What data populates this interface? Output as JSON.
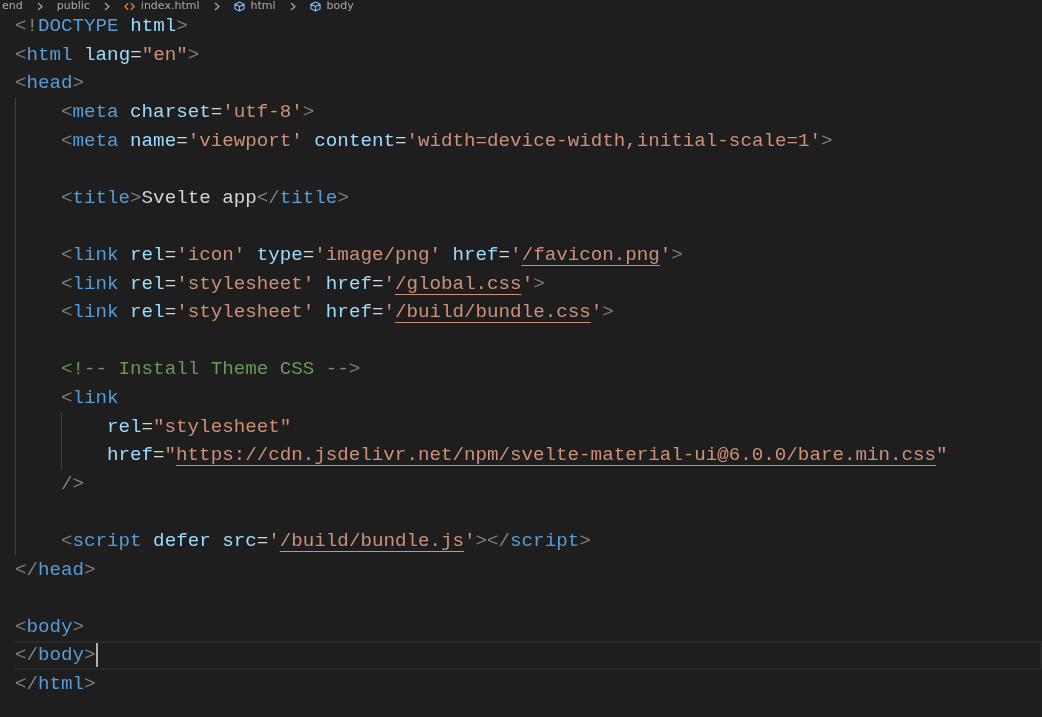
{
  "breadcrumb": [
    {
      "label": "end",
      "kind": "folder"
    },
    {
      "label": "public",
      "kind": "folder"
    },
    {
      "label": "index.html",
      "kind": "file"
    },
    {
      "label": "html",
      "kind": "element"
    },
    {
      "label": "body",
      "kind": "element"
    }
  ],
  "lines": [
    {
      "kind": "code",
      "current": false,
      "tokens": [
        {
          "kind": "punct",
          "text": "<!"
        },
        {
          "kind": "tag",
          "text": "DOCTYPE"
        },
        {
          "kind": "attr",
          "text": " html"
        },
        {
          "kind": "punct",
          "text": ">"
        }
      ]
    },
    {
      "kind": "code",
      "current": false,
      "tokens": [
        {
          "kind": "punct",
          "text": "<"
        },
        {
          "kind": "tag",
          "text": "html"
        },
        {
          "kind": "attr",
          "text": " lang"
        },
        {
          "kind": "text",
          "text": "="
        },
        {
          "kind": "string",
          "text": "\"en\""
        },
        {
          "kind": "punct",
          "text": ">"
        }
      ]
    },
    {
      "kind": "code",
      "current": false,
      "tokens": [
        {
          "kind": "punct",
          "text": "<"
        },
        {
          "kind": "tag",
          "text": "head"
        },
        {
          "kind": "punct",
          "text": ">"
        }
      ],
      "children": [
        {
          "kind": "code",
          "current": false,
          "tokens": [
            {
              "kind": "punct",
              "text": "<"
            },
            {
              "kind": "tag",
              "text": "meta"
            },
            {
              "kind": "attr",
              "text": " charset"
            },
            {
              "kind": "text",
              "text": "="
            },
            {
              "kind": "string",
              "text": "'utf-8'"
            },
            {
              "kind": "punct",
              "text": ">"
            }
          ]
        },
        {
          "kind": "code",
          "current": false,
          "tokens": [
            {
              "kind": "punct",
              "text": "<"
            },
            {
              "kind": "tag",
              "text": "meta"
            },
            {
              "kind": "attr",
              "text": " name"
            },
            {
              "kind": "text",
              "text": "="
            },
            {
              "kind": "string",
              "text": "'viewport'"
            },
            {
              "kind": "attr",
              "text": " content"
            },
            {
              "kind": "text",
              "text": "="
            },
            {
              "kind": "string",
              "text": "'width=device-width,initial-scale=1'"
            },
            {
              "kind": "punct",
              "text": ">"
            }
          ]
        },
        {
          "kind": "blank",
          "current": false
        },
        {
          "kind": "code",
          "current": false,
          "tokens": [
            {
              "kind": "punct",
              "text": "<"
            },
            {
              "kind": "tag",
              "text": "title"
            },
            {
              "kind": "punct",
              "text": ">"
            },
            {
              "kind": "text",
              "text": "Svelte app"
            },
            {
              "kind": "punct",
              "text": "</"
            },
            {
              "kind": "tag",
              "text": "title"
            },
            {
              "kind": "punct",
              "text": ">"
            }
          ]
        },
        {
          "kind": "blank",
          "current": false
        },
        {
          "kind": "code",
          "current": false,
          "tokens": [
            {
              "kind": "punct",
              "text": "<"
            },
            {
              "kind": "tag",
              "text": "link"
            },
            {
              "kind": "attr",
              "text": " rel"
            },
            {
              "kind": "text",
              "text": "="
            },
            {
              "kind": "string",
              "text": "'icon'"
            },
            {
              "kind": "attr",
              "text": " type"
            },
            {
              "kind": "text",
              "text": "="
            },
            {
              "kind": "string",
              "text": "'image/png'"
            },
            {
              "kind": "attr",
              "text": " href"
            },
            {
              "kind": "text",
              "text": "="
            },
            {
              "kind": "string",
              "text": "'"
            },
            {
              "kind": "link",
              "text": "/favicon.png"
            },
            {
              "kind": "string",
              "text": "'"
            },
            {
              "kind": "punct",
              "text": ">"
            }
          ]
        },
        {
          "kind": "code",
          "current": false,
          "tokens": [
            {
              "kind": "punct",
              "text": "<"
            },
            {
              "kind": "tag",
              "text": "link"
            },
            {
              "kind": "attr",
              "text": " rel"
            },
            {
              "kind": "text",
              "text": "="
            },
            {
              "kind": "string",
              "text": "'stylesheet'"
            },
            {
              "kind": "attr",
              "text": " href"
            },
            {
              "kind": "text",
              "text": "="
            },
            {
              "kind": "string",
              "text": "'"
            },
            {
              "kind": "link",
              "text": "/global.css"
            },
            {
              "kind": "string",
              "text": "'"
            },
            {
              "kind": "punct",
              "text": ">"
            }
          ]
        },
        {
          "kind": "code",
          "current": false,
          "tokens": [
            {
              "kind": "punct",
              "text": "<"
            },
            {
              "kind": "tag",
              "text": "link"
            },
            {
              "kind": "attr",
              "text": " rel"
            },
            {
              "kind": "text",
              "text": "="
            },
            {
              "kind": "string",
              "text": "'stylesheet'"
            },
            {
              "kind": "attr",
              "text": " href"
            },
            {
              "kind": "text",
              "text": "="
            },
            {
              "kind": "string",
              "text": "'"
            },
            {
              "kind": "link",
              "text": "/build/bundle.css"
            },
            {
              "kind": "string",
              "text": "'"
            },
            {
              "kind": "punct",
              "text": ">"
            }
          ]
        },
        {
          "kind": "blank",
          "current": false
        },
        {
          "kind": "code",
          "current": false,
          "tokens": [
            {
              "kind": "comment",
              "text": "<!-- Install Theme CSS -->"
            }
          ]
        },
        {
          "kind": "code",
          "current": false,
          "tokens": [
            {
              "kind": "punct",
              "text": "<"
            },
            {
              "kind": "tag",
              "text": "link"
            }
          ],
          "children": [
            {
              "kind": "code",
              "current": false,
              "tokens": [
                {
                  "kind": "attr",
                  "text": "rel"
                },
                {
                  "kind": "text",
                  "text": "="
                },
                {
                  "kind": "string",
                  "text": "\"stylesheet\""
                }
              ]
            },
            {
              "kind": "code",
              "current": false,
              "tokens": [
                {
                  "kind": "attr",
                  "text": "href"
                },
                {
                  "kind": "text",
                  "text": "="
                },
                {
                  "kind": "string",
                  "text": "\""
                },
                {
                  "kind": "link",
                  "text": "https://cdn.jsdelivr.net/npm/svelte-material-ui@6.0.0/bare.min.css"
                },
                {
                  "kind": "string",
                  "text": "\""
                }
              ]
            }
          ]
        },
        {
          "kind": "code",
          "current": false,
          "tokens": [
            {
              "kind": "punct",
              "text": "/>"
            }
          ]
        },
        {
          "kind": "blank",
          "current": false
        },
        {
          "kind": "code",
          "current": false,
          "tokens": [
            {
              "kind": "punct",
              "text": "<"
            },
            {
              "kind": "tag",
              "text": "script"
            },
            {
              "kind": "attr",
              "text": " defer"
            },
            {
              "kind": "attr",
              "text": " src"
            },
            {
              "kind": "text",
              "text": "="
            },
            {
              "kind": "string",
              "text": "'"
            },
            {
              "kind": "link",
              "text": "/build/bundle.js"
            },
            {
              "kind": "string",
              "text": "'"
            },
            {
              "kind": "punct",
              "text": "></"
            },
            {
              "kind": "tag",
              "text": "script"
            },
            {
              "kind": "punct",
              "text": ">"
            }
          ]
        }
      ]
    },
    {
      "kind": "code",
      "current": false,
      "tokens": [
        {
          "kind": "punct",
          "text": "</"
        },
        {
          "kind": "tag",
          "text": "head"
        },
        {
          "kind": "punct",
          "text": ">"
        }
      ]
    },
    {
      "kind": "blank",
      "current": false
    },
    {
      "kind": "code",
      "current": false,
      "tokens": [
        {
          "kind": "punct",
          "text": "<"
        },
        {
          "kind": "tag",
          "text": "body"
        },
        {
          "kind": "punct",
          "text": ">"
        }
      ]
    },
    {
      "kind": "code",
      "current": true,
      "tokens": [
        {
          "kind": "punct",
          "text": "</"
        },
        {
          "kind": "tag",
          "text": "body"
        },
        {
          "kind": "punct",
          "text": ">"
        }
      ]
    },
    {
      "kind": "code",
      "current": false,
      "tokens": [
        {
          "kind": "punct",
          "text": "</"
        },
        {
          "kind": "tag",
          "text": "html"
        },
        {
          "kind": "punct",
          "text": ">"
        }
      ]
    }
  ]
}
